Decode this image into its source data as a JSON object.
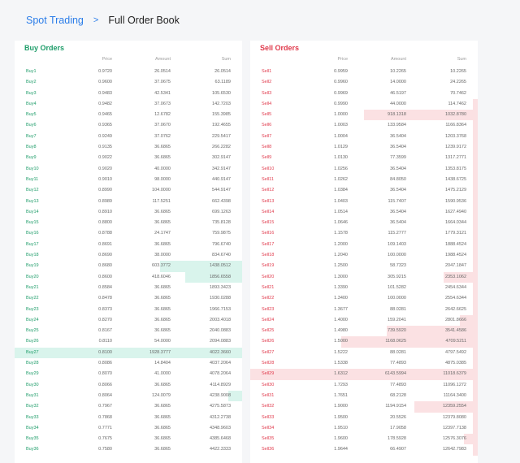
{
  "breadcrumb": {
    "link": "Spot Trading",
    "separator": ">",
    "current": "Full Order Book"
  },
  "columns": {
    "price": "Price",
    "amount": "Amount",
    "sum": "Sum"
  },
  "colors": {
    "buy": "#1f9d6a",
    "sell": "#e0394b",
    "link": "#2b7de9"
  },
  "buy": {
    "title": "Buy Orders",
    "highlight_index": 26,
    "rows": [
      {
        "label": "Buy1",
        "price": "0.9720",
        "amount": "26.0514",
        "sum": "26.0514",
        "depth": 0
      },
      {
        "label": "Buy2",
        "price": "0.9600",
        "amount": "37.0675",
        "sum": "63.1189",
        "depth": 0
      },
      {
        "label": "Buy3",
        "price": "0.9483",
        "amount": "42.5341",
        "sum": "105.6530",
        "depth": 0
      },
      {
        "label": "Buy4",
        "price": "0.9482",
        "amount": "37.0673",
        "sum": "142.7203",
        "depth": 0
      },
      {
        "label": "Buy5",
        "price": "0.9465",
        "amount": "12.6782",
        "sum": "155.3985",
        "depth": 0
      },
      {
        "label": "Buy6",
        "price": "0.9365",
        "amount": "37.0670",
        "sum": "192.4655",
        "depth": 0
      },
      {
        "label": "Buy7",
        "price": "0.9249",
        "amount": "37.0762",
        "sum": "229.5417",
        "depth": 0
      },
      {
        "label": "Buy8",
        "price": "0.9135",
        "amount": "36.6865",
        "sum": "266.2282",
        "depth": 0
      },
      {
        "label": "Buy9",
        "price": "0.9022",
        "amount": "36.6865",
        "sum": "302.9147",
        "depth": 0
      },
      {
        "label": "Buy10",
        "price": "0.9020",
        "amount": "40.0000",
        "sum": "342.9147",
        "depth": 0
      },
      {
        "label": "Buy11",
        "price": "0.9010",
        "amount": "98.0000",
        "sum": "440.9147",
        "depth": 0
      },
      {
        "label": "Buy12",
        "price": "0.8990",
        "amount": "104.0000",
        "sum": "544.9147",
        "depth": 0
      },
      {
        "label": "Buy13",
        "price": "0.8989",
        "amount": "117.5251",
        "sum": "662.4398",
        "depth": 0
      },
      {
        "label": "Buy14",
        "price": "0.8910",
        "amount": "36.6865",
        "sum": "699.1263",
        "depth": 0
      },
      {
        "label": "Buy15",
        "price": "0.8800",
        "amount": "36.6865",
        "sum": "735.8128",
        "depth": 0
      },
      {
        "label": "Buy16",
        "price": "0.8788",
        "amount": "24.1747",
        "sum": "759.9875",
        "depth": 0
      },
      {
        "label": "Buy17",
        "price": "0.8691",
        "amount": "36.6865",
        "sum": "796.6740",
        "depth": 0
      },
      {
        "label": "Buy18",
        "price": "0.8690",
        "amount": "38.0000",
        "sum": "834.6740",
        "depth": 0
      },
      {
        "label": "Buy19",
        "price": "0.8680",
        "amount": "603.3772",
        "sum": "1438.0512",
        "depth": 0.36
      },
      {
        "label": "Buy20",
        "price": "0.8600",
        "amount": "418.6046",
        "sum": "1856.6558",
        "depth": 0.25
      },
      {
        "label": "Buy21",
        "price": "0.8584",
        "amount": "36.6865",
        "sum": "1893.3423",
        "depth": 0
      },
      {
        "label": "Buy22",
        "price": "0.8478",
        "amount": "36.6865",
        "sum": "1930.0288",
        "depth": 0
      },
      {
        "label": "Buy23",
        "price": "0.8373",
        "amount": "36.6865",
        "sum": "1966.7153",
        "depth": 0
      },
      {
        "label": "Buy24",
        "price": "0.8270",
        "amount": "36.6865",
        "sum": "2003.4018",
        "depth": 0
      },
      {
        "label": "Buy25",
        "price": "0.8167",
        "amount": "36.6865",
        "sum": "2040.0883",
        "depth": 0
      },
      {
        "label": "Buy26",
        "price": "0.8110",
        "amount": "54.0000",
        "sum": "2094.0883",
        "depth": 0
      },
      {
        "label": "Buy27",
        "price": "0.8100",
        "amount": "1928.3777",
        "sum": "4022.3660",
        "depth": 1
      },
      {
        "label": "Buy28",
        "price": "0.8086",
        "amount": "14.8404",
        "sum": "4037.2064",
        "depth": 0
      },
      {
        "label": "Buy29",
        "price": "0.8070",
        "amount": "41.0000",
        "sum": "4078.2064",
        "depth": 0
      },
      {
        "label": "Buy30",
        "price": "0.8066",
        "amount": "36.6865",
        "sum": "4114.8929",
        "depth": 0
      },
      {
        "label": "Buy31",
        "price": "0.8064",
        "amount": "124.0079",
        "sum": "4238.9008",
        "depth": 0.06
      },
      {
        "label": "Buy32",
        "price": "0.7967",
        "amount": "36.6865",
        "sum": "4275.5873",
        "depth": 0
      },
      {
        "label": "Buy33",
        "price": "0.7868",
        "amount": "36.6865",
        "sum": "4312.2738",
        "depth": 0
      },
      {
        "label": "Buy34",
        "price": "0.7771",
        "amount": "36.6865",
        "sum": "4348.9603",
        "depth": 0
      },
      {
        "label": "Buy35",
        "price": "0.7675",
        "amount": "36.6865",
        "sum": "4385.6468",
        "depth": 0
      },
      {
        "label": "Buy36",
        "price": "0.7580",
        "amount": "36.6865",
        "sum": "4422.3333",
        "depth": 0
      }
    ]
  },
  "sell": {
    "title": "Sell Orders",
    "highlight_index": 28,
    "rows": [
      {
        "label": "Sell1",
        "price": "0.9959",
        "amount": "10.2265",
        "sum": "10.2265",
        "depth": 0
      },
      {
        "label": "Sell2",
        "price": "0.9960",
        "amount": "14.0000",
        "sum": "24.2265",
        "depth": 0
      },
      {
        "label": "Sell3",
        "price": "0.9969",
        "amount": "46.5197",
        "sum": "70.7462",
        "depth": 0
      },
      {
        "label": "Sell4",
        "price": "0.9990",
        "amount": "44.0000",
        "sum": "114.7462",
        "depth": 0.02
      },
      {
        "label": "Sell5",
        "price": "1.0000",
        "amount": "918.1318",
        "sum": "1032.8780",
        "depth": 0.5
      },
      {
        "label": "Sell6",
        "price": "1.0003",
        "amount": "133.9584",
        "sum": "1166.8364",
        "depth": 0.02
      },
      {
        "label": "Sell7",
        "price": "1.0004",
        "amount": "36.5404",
        "sum": "1203.3768",
        "depth": 0.02
      },
      {
        "label": "Sell8",
        "price": "1.0129",
        "amount": "36.5404",
        "sum": "1239.9172",
        "depth": 0.02
      },
      {
        "label": "Sell9",
        "price": "1.0130",
        "amount": "77.3599",
        "sum": "1317.2771",
        "depth": 0.02
      },
      {
        "label": "Sell10",
        "price": "1.0256",
        "amount": "36.5404",
        "sum": "1353.8175",
        "depth": 0.02
      },
      {
        "label": "Sell11",
        "price": "1.0262",
        "amount": "84.8050",
        "sum": "1438.6725",
        "depth": 0.02
      },
      {
        "label": "Sell12",
        "price": "1.0384",
        "amount": "36.5404",
        "sum": "1475.2129",
        "depth": 0.02
      },
      {
        "label": "Sell13",
        "price": "1.0403",
        "amount": "115.7407",
        "sum": "1590.9536",
        "depth": 0.02
      },
      {
        "label": "Sell14",
        "price": "1.0514",
        "amount": "36.5404",
        "sum": "1627.4940",
        "depth": 0.02
      },
      {
        "label": "Sell15",
        "price": "1.0646",
        "amount": "36.5404",
        "sum": "1664.0344",
        "depth": 0.02
      },
      {
        "label": "Sell16",
        "price": "1.1578",
        "amount": "115.2777",
        "sum": "1779.3121",
        "depth": 0.02
      },
      {
        "label": "Sell17",
        "price": "1.2000",
        "amount": "109.1403",
        "sum": "1888.4524",
        "depth": 0.02
      },
      {
        "label": "Sell18",
        "price": "1.2040",
        "amount": "100.0000",
        "sum": "1988.4524",
        "depth": 0.02
      },
      {
        "label": "Sell19",
        "price": "1.2500",
        "amount": "58.7323",
        "sum": "2047.1847",
        "depth": 0.02
      },
      {
        "label": "Sell20",
        "price": "1.3000",
        "amount": "305.9215",
        "sum": "2353.1062",
        "depth": 0.15
      },
      {
        "label": "Sell21",
        "price": "1.3390",
        "amount": "101.5282",
        "sum": "2454.6344",
        "depth": 0.02
      },
      {
        "label": "Sell22",
        "price": "1.3400",
        "amount": "100.0000",
        "sum": "2554.6344",
        "depth": 0.02
      },
      {
        "label": "Sell23",
        "price": "1.3677",
        "amount": "88.0281",
        "sum": "2642.6625",
        "depth": 0.02
      },
      {
        "label": "Sell24",
        "price": "1.4000",
        "amount": "159.2041",
        "sum": "2801.8666",
        "depth": 0.08
      },
      {
        "label": "Sell25",
        "price": "1.4980",
        "amount": "739.5920",
        "sum": "3541.4586",
        "depth": 0.4
      },
      {
        "label": "Sell26",
        "price": "1.5000",
        "amount": "1168.0625",
        "sum": "4709.5211",
        "depth": 0.6
      },
      {
        "label": "Sell27",
        "price": "1.5222",
        "amount": "88.0281",
        "sum": "4797.5492",
        "depth": 0.02
      },
      {
        "label": "Sell28",
        "price": "1.5338",
        "amount": "77.4893",
        "sum": "4875.0385",
        "depth": 0.02
      },
      {
        "label": "Sell29",
        "price": "1.6312",
        "amount": "6143.5994",
        "sum": "11018.6379",
        "depth": 1
      },
      {
        "label": "Sell30",
        "price": "1.7293",
        "amount": "77.4893",
        "sum": "11096.1272",
        "depth": 0.02
      },
      {
        "label": "Sell31",
        "price": "1.7651",
        "amount": "68.2128",
        "sum": "11164.3400",
        "depth": 0.02
      },
      {
        "label": "Sell32",
        "price": "1.9000",
        "amount": "1194.9154",
        "sum": "12359.2554",
        "depth": 0.28
      },
      {
        "label": "Sell33",
        "price": "1.9500",
        "amount": "20.5526",
        "sum": "12379.8080",
        "depth": 0.02
      },
      {
        "label": "Sell34",
        "price": "1.9510",
        "amount": "17.9058",
        "sum": "12397.7138",
        "depth": 0.02
      },
      {
        "label": "Sell35",
        "price": "1.9600",
        "amount": "178.5928",
        "sum": "12576.3076",
        "depth": 0.06
      },
      {
        "label": "Sell36",
        "price": "1.9644",
        "amount": "66.4907",
        "sum": "12642.7983",
        "depth": 0.02
      }
    ]
  }
}
